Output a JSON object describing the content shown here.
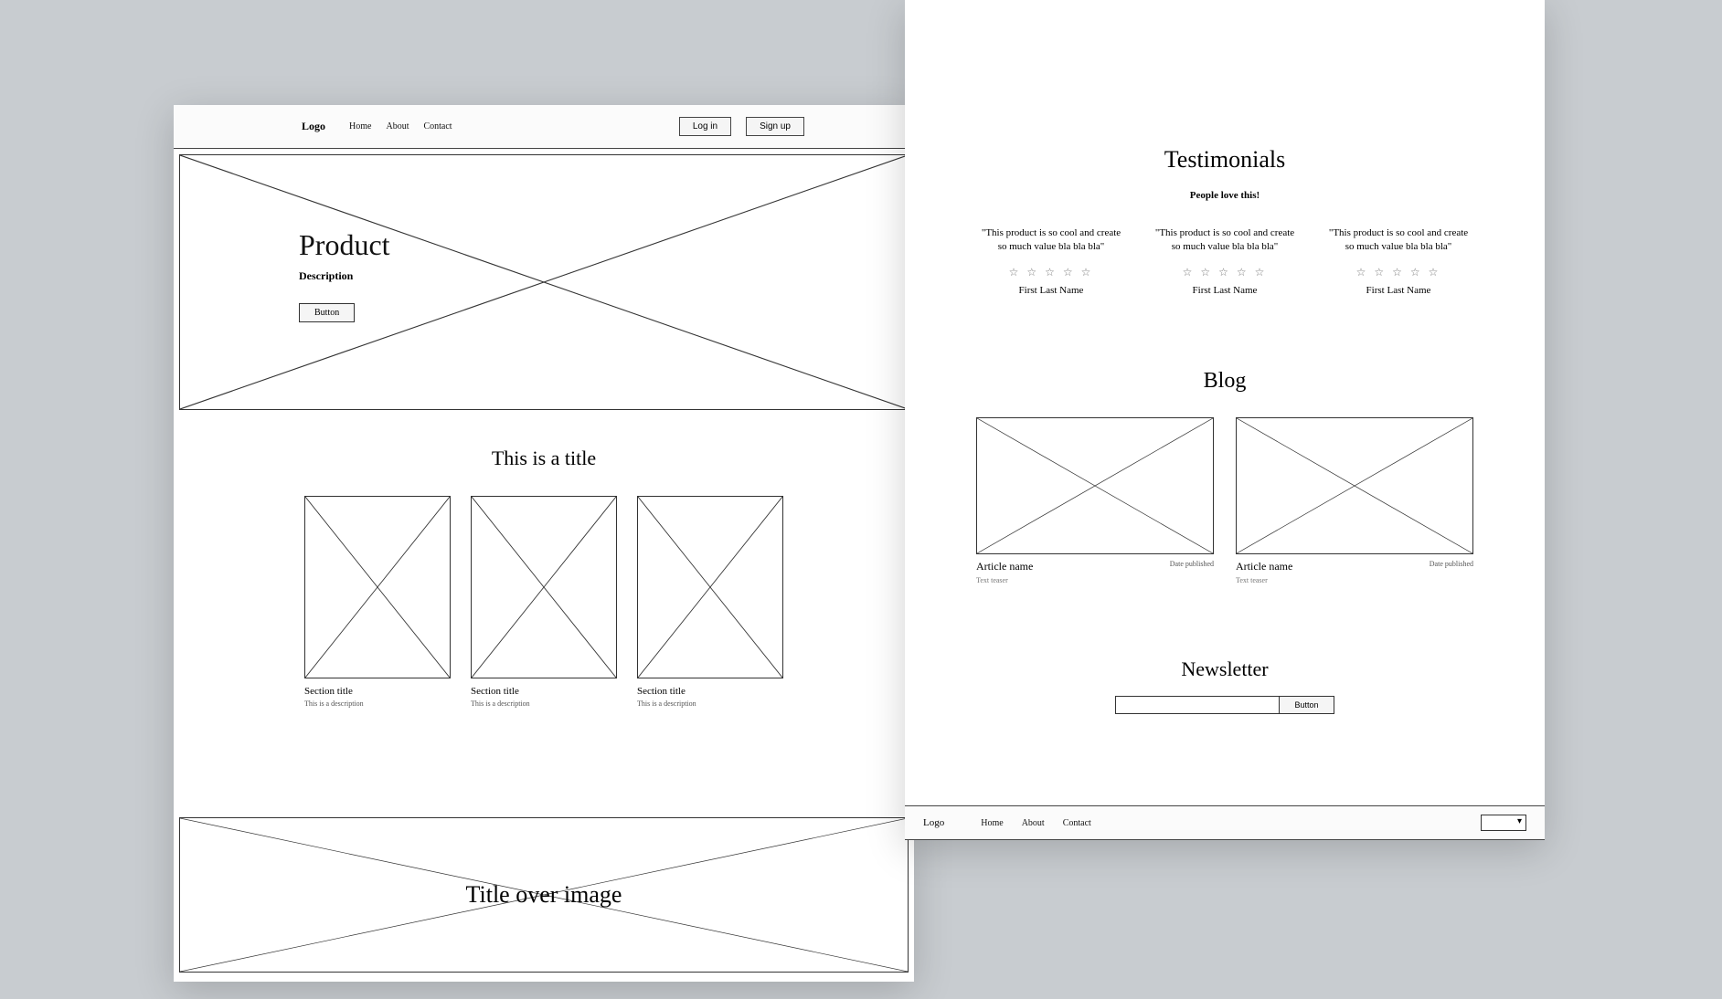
{
  "left": {
    "nav": {
      "logo": "Logo",
      "links": [
        "Home",
        "About",
        "Contact"
      ],
      "login": "Log in",
      "signup": "Sign up"
    },
    "hero": {
      "title": "Product",
      "description": "Description",
      "button": "Button"
    },
    "section": {
      "title": "This is a title",
      "cards": [
        {
          "title": "Section title",
          "desc": "This is a description"
        },
        {
          "title": "Section title",
          "desc": "This is a description"
        },
        {
          "title": "Section title",
          "desc": "This is a description"
        }
      ]
    },
    "over_image": {
      "title": "Title over image"
    }
  },
  "right": {
    "testimonials": {
      "title": "Testimonials",
      "subtitle": "People love this!",
      "items": [
        {
          "quote": "\"This product is so cool and create so much value bla bla bla\"",
          "name": "First Last Name"
        },
        {
          "quote": "\"This product is so cool and create so much value bla bla bla\"",
          "name": "First Last Name"
        },
        {
          "quote": "\"This product is so cool and create so much value bla bla bla\"",
          "name": "First Last Name"
        }
      ],
      "stars": "☆ ☆ ☆ ☆ ☆"
    },
    "blog": {
      "title": "Blog",
      "items": [
        {
          "article": "Article name",
          "date": "Date published",
          "teaser": "Text teaser"
        },
        {
          "article": "Article name",
          "date": "Date published",
          "teaser": "Text teaser"
        }
      ]
    },
    "newsletter": {
      "title": "Newsletter",
      "button": "Button"
    },
    "footer": {
      "logo": "Logo",
      "links": [
        "Home",
        "About",
        "Contact"
      ]
    }
  }
}
